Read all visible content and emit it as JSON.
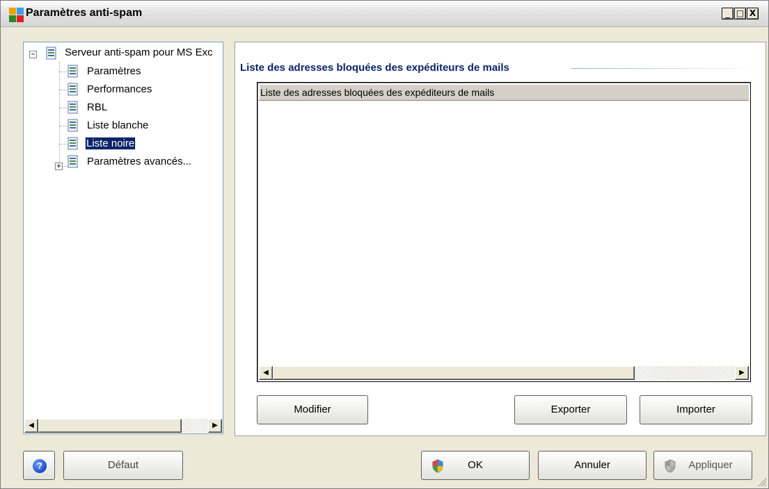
{
  "window": {
    "title": "Paramètres anti-spam",
    "minimize_glyph": "_",
    "maximize_glyph": "□",
    "close_glyph": "X"
  },
  "tree": {
    "root_label": "Serveur anti-spam pour MS Exc",
    "items": [
      {
        "label": "Paramètres"
      },
      {
        "label": "Performances"
      },
      {
        "label": "RBL"
      },
      {
        "label": "Liste blanche"
      },
      {
        "label": "Liste noire",
        "selected": true
      },
      {
        "label": "Paramètres avancés...",
        "expandable": true
      }
    ],
    "collapse_glyph": "−",
    "expand_glyph": "+"
  },
  "scroll_glyphs": {
    "left": "◀",
    "right": "▶"
  },
  "content": {
    "section_title": "Liste des adresses bloquées des expéditeurs de mails",
    "list_header": "Liste des adresses bloquées des expéditeurs de mails",
    "rows": [],
    "buttons": {
      "modify": "Modifier",
      "export": "Exporter",
      "import": "Importer"
    }
  },
  "footer": {
    "help_glyph": "?",
    "default_label": "Défaut",
    "ok_label": "OK",
    "cancel_label": "Annuler",
    "apply_label": "Appliquer"
  },
  "icons": [
    "app-icon",
    "document-icon",
    "help-icon",
    "shield-icon",
    "resize-grip-icon"
  ],
  "colors": {
    "selection": "#0a246a",
    "section_title": "#0a246a",
    "dialog_background": "#ece9d8"
  }
}
